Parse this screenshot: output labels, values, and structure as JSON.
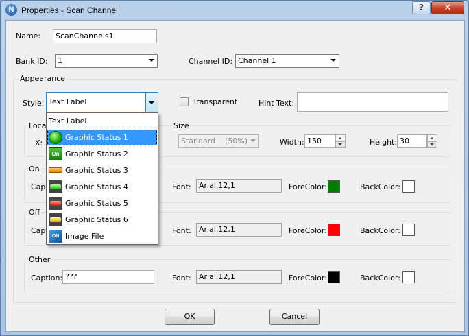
{
  "window": {
    "title": "Properties - Scan Channel",
    "app_icon_letter": "N",
    "help_glyph": "?",
    "close_glyph": "✕"
  },
  "form": {
    "name_label": "Name:",
    "name_value": "ScanChannels1",
    "bank_id_label": "Bank ID:",
    "bank_id_value": "1",
    "channel_id_label": "Channel ID:",
    "channel_id_value": "Channel 1"
  },
  "appearance": {
    "group_label": "Appearance",
    "style_label": "Style:",
    "style_value": "Text Label",
    "transparent_label": "Transparent",
    "transparent_checked": false,
    "hint_text_label": "Hint Text:",
    "hint_text_value": "",
    "location_label": "Loca",
    "x_label": "X:",
    "size_label": "Size",
    "size_value": "Standard    (50%)",
    "width_label": "Width:",
    "width_value": "150",
    "height_label": "Height:",
    "height_value": "30"
  },
  "style_dropdown": {
    "items": [
      {
        "label": "Text Label",
        "icon": "none"
      },
      {
        "label": "Graphic Status 1",
        "icon": "green-circle-icon",
        "selected": true
      },
      {
        "label": "Graphic Status 2",
        "icon": "on-badge-icon"
      },
      {
        "label": "Graphic Status 3",
        "icon": "orange-bar-icon"
      },
      {
        "label": "Graphic Status 4",
        "icon": "green-led-bar-icon"
      },
      {
        "label": "Graphic Status 5",
        "icon": "red-led-bar-icon"
      },
      {
        "label": "Graphic Status 6",
        "icon": "yellow-led-bar-icon"
      },
      {
        "label": "Image File",
        "icon": "image-file-icon"
      }
    ],
    "on_badge_text": "On",
    "image_badge_text": "ON"
  },
  "on_group": {
    "label": "On",
    "caption_label": "Capti",
    "font_label": "Font:",
    "font_value": "Arial,12,1",
    "forecolor_label": "ForeColor:",
    "forecolor": "#007f00",
    "backcolor_label": "BackColor:",
    "backcolor": "#ffffff"
  },
  "off_group": {
    "label": "Off",
    "caption_label": "Capti",
    "font_label": "Font:",
    "font_value": "Arial,12,1",
    "forecolor_label": "ForeColor:",
    "forecolor": "#ff0000",
    "backcolor_label": "BackColor:",
    "backcolor": "#ffffff"
  },
  "other_group": {
    "label": "Other",
    "caption_label": "Caption:",
    "caption_value": "???",
    "font_label": "Font:",
    "font_value": "Arial,12,1",
    "forecolor_label": "ForeColor:",
    "forecolor": "#000000",
    "backcolor_label": "BackColor:",
    "backcolor": "#ffffff"
  },
  "buttons": {
    "ok_label": "OK",
    "cancel_label": "Cancel"
  }
}
